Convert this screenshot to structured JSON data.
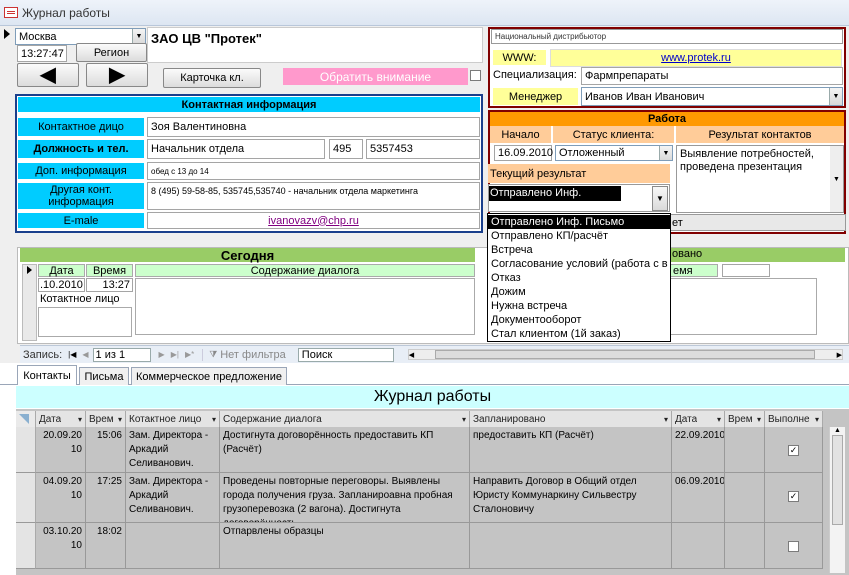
{
  "window": {
    "title": "Журнал работы"
  },
  "header": {
    "city": "Москва",
    "time": "13:27:47",
    "region_button": "Регион",
    "company": "ЗАО ЦВ \"Протек\"",
    "client_card_button": "Карточка кл.",
    "attention_label": "Обратить внимание"
  },
  "distributor": {
    "label": "Национальный дистрибьютор",
    "www_label": "WWW:",
    "www_value": "www.protek.ru",
    "spec_label": "Специализация:",
    "spec_value": "Фармпрепараты",
    "manager_label": "Менеджер",
    "manager_value": "Иванов Иван Иванович"
  },
  "contact": {
    "title": "Контактная информация",
    "person_label": "Контактное дицо",
    "person_value": "Зоя Валентиновна",
    "position_label": "Должность и тел.",
    "position_value": "Начальник отдела",
    "phone_code": "495",
    "phone_number": "5357453",
    "extra_label": "Доп. информация",
    "extra_value": "обед с 13 до 14",
    "other_label": "Другая конт. информация",
    "other_value": "8 (495) 59-58-85, 535745,535740 - начальник отдела маркетинга",
    "email_label": "E-male",
    "email_value": "ivanovazv@chp.ru"
  },
  "work": {
    "title": "Работа",
    "start_label": "Начало",
    "status_label": "Статус клиента:",
    "result_label": "Результат контактов",
    "start_value": "16.09.2010",
    "status_value": "Отложенный",
    "result_value": "Выявление потребностей, проведена презентация",
    "current_label": "Текущий результат",
    "current_value": "Отправлено Инф. Письмо",
    "options": [
      "Отправлено Инф. Письмо",
      "Отправлено КП/расчёт",
      "Встреча",
      "Согласование условий (работа с в",
      "Отказ",
      "Дожим",
      "Нужна встреча",
      "Документооборот",
      "Стал клиентом (1й заказ)"
    ],
    "hidden_button_fragment": "ет"
  },
  "today": {
    "title": "Сегодня",
    "planned_title_fragment": "овано",
    "col_date": "Дата",
    "col_time": "Время",
    "col_content": "Содержание диалога",
    "col_time_right": "емя",
    "row_date": ".10.2010",
    "row_time": "13:27",
    "contact_label": "Котактное лицо"
  },
  "nav": {
    "record_label": "Запись:",
    "record_value": "1 из 1",
    "filter_label": "Нет фильтра",
    "search_label": "Поиск"
  },
  "tabs": [
    "Контакты",
    "Письма",
    "Коммерческое предложение"
  ],
  "journal": {
    "title": "Журнал работы",
    "columns": [
      "Дата",
      "Врем",
      "Котактное лицо",
      "Содержание диалога",
      "Запланировано",
      "Дата",
      "Врем",
      "Выполне"
    ],
    "rows": [
      {
        "date": "20.09.2010",
        "time": "15:06",
        "contact": "Зам. Директора - Аркадий Селиванович.",
        "content": "Достигнута договорённость предоставить КП (Расчёт)",
        "planned": "предоставить КП (Расчёт)",
        "pdate": "22.09.2010",
        "ptime": "",
        "done": true
      },
      {
        "date": "04.09.2010",
        "time": "17:25",
        "contact": "Зам. Директора - Аркадий Селиванович.",
        "content": "Проведены повторные переговоры. Выявлены города получения груза. Запланироавна пробная грузоперевозка (2 вагона). Достигнута договорённость",
        "planned": "Направить Договор в Общий отдел Юристу Коммунаркину Сильвестру Сталоновичу",
        "pdate": "06.09.2010",
        "ptime": "",
        "done": true
      },
      {
        "date": "03.10.2010",
        "time": "18:02",
        "contact": "",
        "content": "Отпарвлены образцы",
        "planned": "",
        "pdate": "",
        "ptime": "",
        "done": false
      }
    ]
  }
}
